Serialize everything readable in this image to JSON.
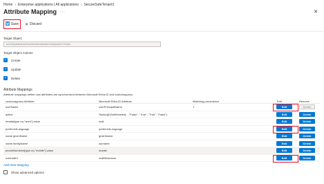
{
  "breadcrumb": [
    "Home",
    "Enterprise applications | All applications",
    "SecureSafeTenant1"
  ],
  "title": "Attribute Mapping",
  "title_more": "···",
  "toolbar": {
    "save_label": "Save",
    "discard_label": "Discard"
  },
  "target_object": {
    "label": "Target Object",
    "value": "urn:ietf:params:scim:schemas:extension:enterprise:2.0:User"
  },
  "target_actions": {
    "label": "Target Object Actions",
    "items": [
      {
        "label": "Create",
        "checked": true
      },
      {
        "label": "Update",
        "checked": true
      },
      {
        "label": "Delete",
        "checked": true
      }
    ]
  },
  "mappings": {
    "heading": "Attribute Mappings",
    "description": "Attribute mappings define how attributes are synchronized between Microsoft Entra ID and customappsso",
    "columns": {
      "customappsso": "customappsso Attribute",
      "entra": "Microsoft Entra ID Attribute",
      "precedence": "Matching precedence",
      "edit": "Edit",
      "remove": "Remove"
    },
    "edit_label": "Edit",
    "delete_label": "Delete",
    "rows": [
      {
        "customappsso": "userName",
        "entra": "userPrincipalName",
        "precedence": "1",
        "delete_enabled": false,
        "highlighted": true
      },
      {
        "customappsso": "active",
        "entra": "Switch([IsSoftDeleted], , \"False\", \"True\", \"True\", \"False\")",
        "precedence": "",
        "delete_enabled": true,
        "highlighted": false
      },
      {
        "customappsso": "emails[type eq \"work\"].value",
        "entra": "mail",
        "precedence": "",
        "delete_enabled": true,
        "highlighted": false
      },
      {
        "customappsso": "preferredLanguage",
        "entra": "preferredLanguage",
        "precedence": "",
        "delete_enabled": true,
        "highlighted": true
      },
      {
        "customappsso": "name.givenName",
        "entra": "givenName",
        "precedence": "",
        "delete_enabled": true,
        "highlighted": false
      },
      {
        "customappsso": "name.familyName",
        "entra": "surname",
        "precedence": "",
        "delete_enabled": true,
        "highlighted": false
      },
      {
        "customappsso": "phoneNumbers[type eq \"mobile\"].value",
        "entra": "mobile",
        "precedence": "",
        "delete_enabled": true,
        "highlighted": false
      },
      {
        "customappsso": "externalId",
        "entra": "mailNickname",
        "precedence": "",
        "delete_enabled": true,
        "highlighted": true
      }
    ],
    "add_new_label": "Add New Mapping",
    "advanced": {
      "label": "Show advanced options",
      "checked": false
    }
  }
}
